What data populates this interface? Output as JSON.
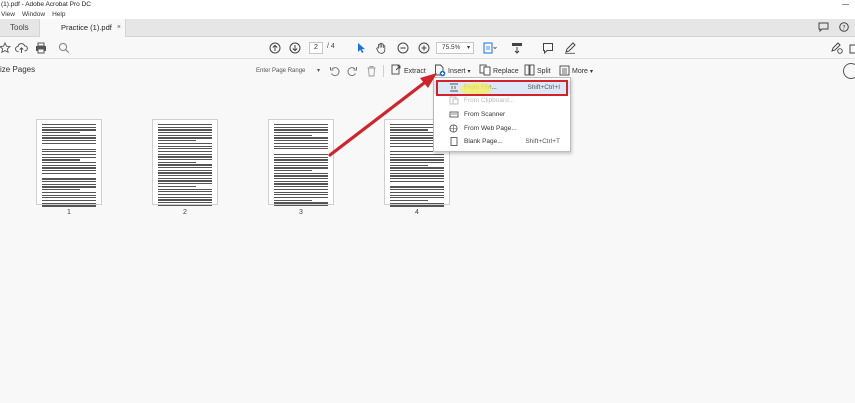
{
  "window": {
    "title": "(1).pdf - Adobe Acrobat Pro DC"
  },
  "menubar": {
    "items": [
      "View",
      "Window",
      "Help"
    ]
  },
  "tabs": {
    "tools": "Tools",
    "document": "Practice (1).pdf",
    "close": "×"
  },
  "toolbar": {
    "current_page": "2",
    "total_pages": "/ 4",
    "zoom": "75.5%"
  },
  "organize": {
    "title": "ize Pages",
    "page_range_placeholder": "Enter Page Range",
    "extract": "Extract",
    "insert": "Insert",
    "replace": "Replace",
    "split": "Split",
    "more": "More"
  },
  "insert_menu": {
    "items": [
      {
        "label": "From File...",
        "shortcut": "Shift+Ctrl+I",
        "enabled": true,
        "highlighted": true,
        "icon": "insert-file-icon"
      },
      {
        "label": "From Clipboard...",
        "shortcut": "",
        "enabled": false,
        "highlighted": false,
        "icon": "clipboard-icon"
      },
      {
        "label": "From Scanner",
        "shortcut": "",
        "enabled": true,
        "highlighted": false,
        "icon": "scanner-icon"
      },
      {
        "label": "From Web Page...",
        "shortcut": "",
        "enabled": true,
        "highlighted": false,
        "icon": "web-page-icon"
      },
      {
        "label": "Blank Page...",
        "shortcut": "Shift+Ctrl+T",
        "enabled": true,
        "highlighted": false,
        "icon": "blank-page-icon"
      }
    ]
  },
  "pages": [
    "1",
    "2",
    "3",
    "4"
  ],
  "colors": {
    "annotation_red": "#d2232a",
    "accent_blue": "#1473e6",
    "highlight_yellow": "#f5ee6a"
  }
}
